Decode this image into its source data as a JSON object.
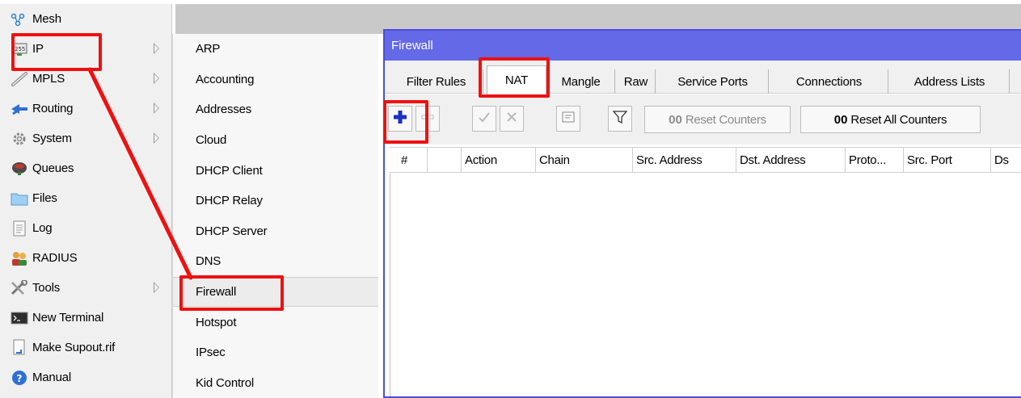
{
  "left_menu": {
    "items": [
      {
        "label": "Mesh",
        "icon": "mesh-icon"
      },
      {
        "label": "IP",
        "icon": "ip-icon",
        "has_submenu": true
      },
      {
        "label": "MPLS",
        "icon": "mpls-icon",
        "has_submenu": true
      },
      {
        "label": "Routing",
        "icon": "routing-icon",
        "has_submenu": true
      },
      {
        "label": "System",
        "icon": "system-gear-icon",
        "has_submenu": true
      },
      {
        "label": "Queues",
        "icon": "queues-icon"
      },
      {
        "label": "Files",
        "icon": "folder-icon"
      },
      {
        "label": "Log",
        "icon": "log-icon"
      },
      {
        "label": "RADIUS",
        "icon": "radius-users-icon"
      },
      {
        "label": "Tools",
        "icon": "tools-icon",
        "has_submenu": true
      },
      {
        "label": "New Terminal",
        "icon": "terminal-icon"
      },
      {
        "label": "Make Supout.rif",
        "icon": "document-arrow-icon"
      },
      {
        "label": "Manual",
        "icon": "help-icon"
      }
    ]
  },
  "ip_submenu": {
    "items": [
      {
        "label": "ARP"
      },
      {
        "label": "Accounting"
      },
      {
        "label": "Addresses"
      },
      {
        "label": "Cloud"
      },
      {
        "label": "DHCP Client"
      },
      {
        "label": "DHCP Relay"
      },
      {
        "label": "DHCP Server"
      },
      {
        "label": "DNS"
      },
      {
        "label": "Firewall",
        "selected": true
      },
      {
        "label": "Hotspot"
      },
      {
        "label": "IPsec"
      },
      {
        "label": "Kid Control"
      }
    ]
  },
  "firewall_window": {
    "title": "Firewall",
    "tabs": [
      {
        "label": "Filter Rules"
      },
      {
        "label": "NAT",
        "active": true
      },
      {
        "label": "Mangle"
      },
      {
        "label": "Raw"
      },
      {
        "label": "Service Ports"
      },
      {
        "label": "Connections"
      },
      {
        "label": "Address Lists"
      }
    ],
    "toolbar": {
      "add_icon": "plus-icon",
      "remove_icon": "minus-icon",
      "enable_icon": "check-icon",
      "disable_icon": "x-icon",
      "comment_icon": "comment-icon",
      "filter_icon": "filter-icon",
      "reset_counters_prefix": "00",
      "reset_counters_label": "Reset Counters",
      "reset_all_counters_prefix": "00",
      "reset_all_counters_label": "Reset All Counters"
    },
    "table": {
      "columns": [
        "#",
        "",
        "Action",
        "Chain",
        "Src. Address",
        "Dst. Address",
        "Proto...",
        "Src. Port",
        "Ds"
      ],
      "rows": []
    }
  },
  "colors": {
    "highlight": "#ee1111",
    "titlebar": "#6469e8",
    "add_plus": "#1b2fc2"
  }
}
